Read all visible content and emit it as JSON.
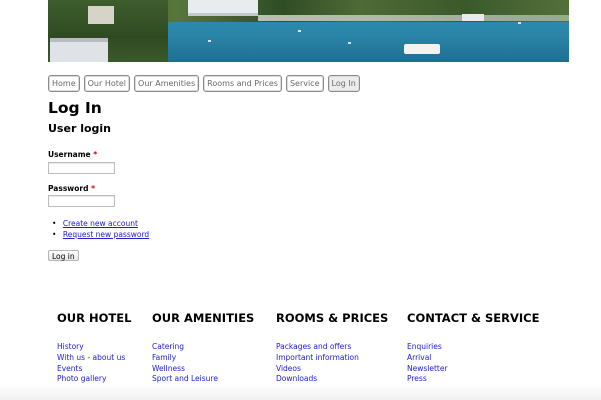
{
  "nav": {
    "tabs": [
      {
        "label": "Home"
      },
      {
        "label": "Our Hotel"
      },
      {
        "label": "Our Amenities"
      },
      {
        "label": "Rooms and Prices"
      },
      {
        "label": "Service"
      },
      {
        "label": "Log In",
        "active": true
      }
    ]
  },
  "main": {
    "page_title": "Log In",
    "block_title": "User login",
    "username_label": "Username",
    "password_label": "Password",
    "required_marker": "*",
    "username_value": "",
    "password_value": "",
    "links": [
      {
        "label": "Create new account"
      },
      {
        "label": "Request new password"
      }
    ],
    "submit_label": "Log in"
  },
  "footer": {
    "columns": [
      {
        "heading": "OUR HOTEL",
        "items": [
          "History",
          "With us - about us",
          "Events",
          "Photo gallery"
        ]
      },
      {
        "heading": "OUR AMENITIES",
        "items": [
          "Catering",
          "Family",
          "Wellness",
          "Sport and Leisure"
        ]
      },
      {
        "heading": "ROOMS & PRICES",
        "items": [
          "Packages and offers",
          "Important information",
          "Videos",
          "Downloads"
        ]
      },
      {
        "heading": "CONTACT & SERVICE",
        "items": [
          "Enquiries",
          "Arrival",
          "Newsletter",
          "Press"
        ]
      }
    ]
  },
  "colors": {
    "link": "#2020d0",
    "required": "#cc0000",
    "tab_border": "#8c8c8c",
    "tab_text": "#6a6a6a"
  }
}
